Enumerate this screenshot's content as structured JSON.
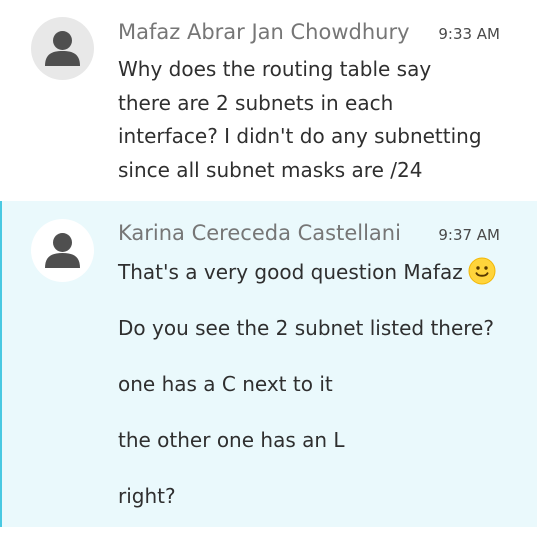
{
  "messages": [
    {
      "sender": "Mafaz Abrar Jan Chowdhury",
      "time": "9:33 AM",
      "text": "Why does the routing table say there are 2 subnets in each interface? I didn't do any subnetting since all subnet masks are /24",
      "avatar_icon": "default-user-avatar-icon"
    },
    {
      "sender": "Karina Cereceda Castellani",
      "time": "9:37 AM",
      "lines": [
        "That's a very good question Mafaz",
        "Do you see the 2 subnet listed there?",
        "one has a C next to it",
        "the other one has an L",
        "right?"
      ],
      "emoji": "slightly-smiling-face-icon",
      "avatar_icon": "default-user-avatar-icon"
    }
  ],
  "colors": {
    "selected_message_background": "#eaf9fc",
    "selected_message_border": "#49c9e2",
    "sender_name": "#767676",
    "message_text": "#2f2f2f"
  }
}
